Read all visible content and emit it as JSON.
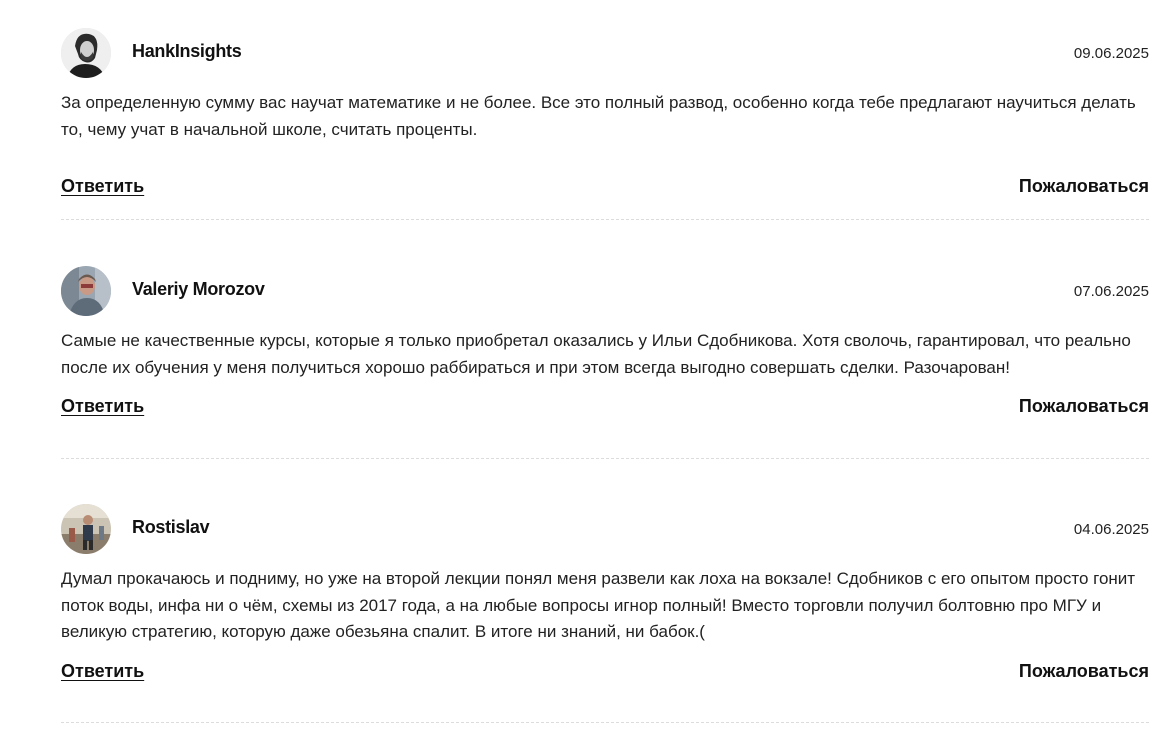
{
  "comments": [
    {
      "author": "HankInsights",
      "date": "09.06.2025",
      "text": "За определенную сумму вас научат математике и не более. Все это полный развод, особенно когда тебе предлагают научиться делать то, чему учат в начальной школе, считать проценты.",
      "reply_label": "Ответить",
      "report_label": "Пожаловаться"
    },
    {
      "author": "Valeriy Morozov",
      "date": "07.06.2025",
      "text": "Самые не качественные курсы, которые я только приобретал оказались у Ильи Сдобникова. Хотя сволочь, гарантировал, что реально после их обучения у меня получиться хорошо раббираться и при этом всегда выгодно совершать сделки. Разочарован!",
      "reply_label": "Ответить",
      "report_label": "Пожаловаться"
    },
    {
      "author": "Rostislav",
      "date": "04.06.2025",
      "text": "Думал прокачаюсь и подниму, но уже на второй лекции понял меня развели как лоха на вокзале! Сдобников с его опытом просто гонит поток воды, инфа ни о чём, схемы из 2017 года, а на любые вопросы игнор полный! Вместо торговли получил болтовню про МГУ и великую стратегию, которую даже обезьяна спалит. В итоге ни знаний, ни бабок.(",
      "reply_label": "Ответить",
      "report_label": "Пожаловаться"
    }
  ]
}
